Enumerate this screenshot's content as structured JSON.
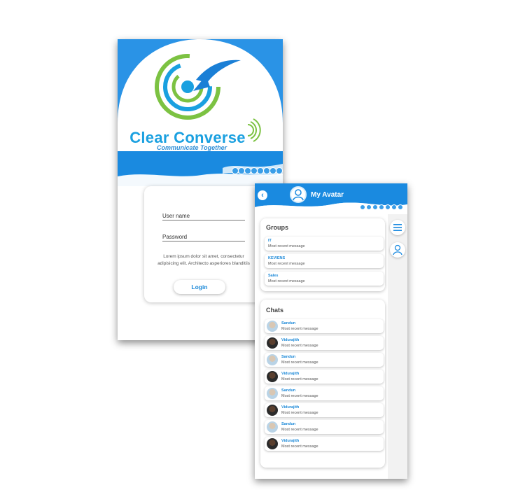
{
  "login": {
    "app_name": "Clear Converse",
    "tagline": "Communicate Together",
    "username_label": "User name",
    "password_label": "Password",
    "lorem": "Lorem ipsum dolor sit amet, consectetur adipisicing elit. Architecto asperiores blanditiis",
    "login_label": "Login"
  },
  "chat_screen": {
    "title": "My Avatar",
    "back_icon": "back-arrow-icon",
    "groups_title": "Groups",
    "groups": [
      {
        "name": "IT",
        "message": "Most recent message"
      },
      {
        "name": "KEVIENS",
        "message": "Most recent message"
      },
      {
        "name": "Sales",
        "message": "Most recent message"
      }
    ],
    "chats_title": "Chats",
    "chats": [
      {
        "name": "Sandun",
        "message": "Most recent message"
      },
      {
        "name": "Vidurajith",
        "message": "Most recent message"
      },
      {
        "name": "Sandun",
        "message": "Most recent message"
      },
      {
        "name": "Vidurajith",
        "message": "Most recent message"
      },
      {
        "name": "Sandun",
        "message": "Most recent message"
      },
      {
        "name": "Vidurajith",
        "message": "Most recent message"
      },
      {
        "name": "Sandun",
        "message": "Most recent message"
      },
      {
        "name": "Vidurajith",
        "message": "Most recent message"
      }
    ]
  },
  "colors": {
    "brand_blue": "#1a8ae0",
    "brand_green": "#7cc242",
    "accent_blue": "#1aa0e0"
  }
}
